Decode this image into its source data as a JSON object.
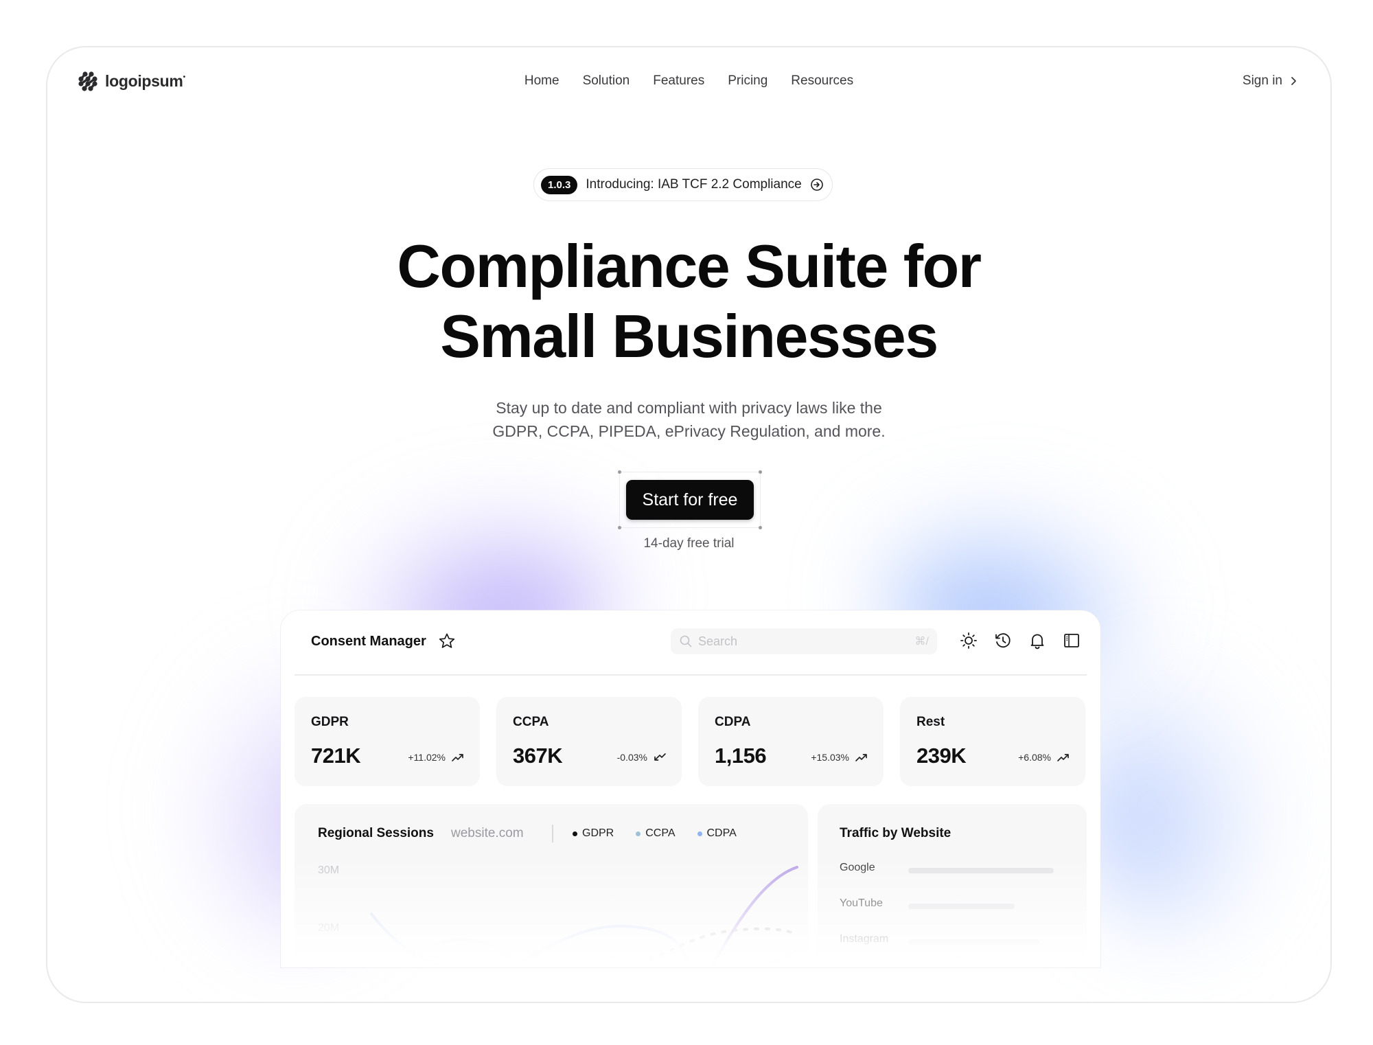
{
  "brand": {
    "name": "logoipsum",
    "mark": "•"
  },
  "nav": {
    "links": [
      "Home",
      "Solution",
      "Features",
      "Pricing",
      "Resources"
    ],
    "signin_label": "Sign in"
  },
  "announcement": {
    "version": "1.0.3",
    "text": "Introducing: IAB TCF 2.2 Compliance"
  },
  "hero": {
    "title_line1": "Compliance Suite for",
    "title_line2": "Small Businesses",
    "subtitle_line1": "Stay up to date and compliant with privacy laws like the",
    "subtitle_line2": "GDPR, CCPA, PIPEDA, ePrivacy Regulation, and more.",
    "cta_label": "Start for free",
    "trial_note": "14-day free trial"
  },
  "dashboard": {
    "title": "Consent Manager",
    "search": {
      "placeholder": "Search",
      "shortcut": "⌘/"
    },
    "header_icons": [
      "sun-icon",
      "history-icon",
      "bell-icon",
      "sidebar-icon"
    ],
    "stats": [
      {
        "label": "GDPR",
        "value": "721K",
        "change": "+11.02%",
        "trend": "up"
      },
      {
        "label": "CCPA",
        "value": "367K",
        "change": "-0.03%",
        "trend": "down"
      },
      {
        "label": "CDPA",
        "value": "1,156",
        "change": "+15.03%",
        "trend": "up"
      },
      {
        "label": "Rest",
        "value": "239K",
        "change": "+6.08%",
        "trend": "up"
      }
    ],
    "sessions": {
      "title": "Regional Sessions",
      "site": "website.com",
      "legend": [
        {
          "name": "GDPR",
          "color": "#111111"
        },
        {
          "name": "CCPA",
          "color": "#9fc3d6"
        },
        {
          "name": "CDPA",
          "color": "#8fb4ee"
        }
      ],
      "y_ticks": [
        "30M",
        "20M"
      ]
    },
    "traffic": {
      "title": "Traffic by Website",
      "rows": [
        {
          "label": "Google",
          "share": 1.0
        },
        {
          "label": "YouTube",
          "share": 0.73
        },
        {
          "label": "Instagram",
          "share": 0.9
        }
      ]
    }
  }
}
